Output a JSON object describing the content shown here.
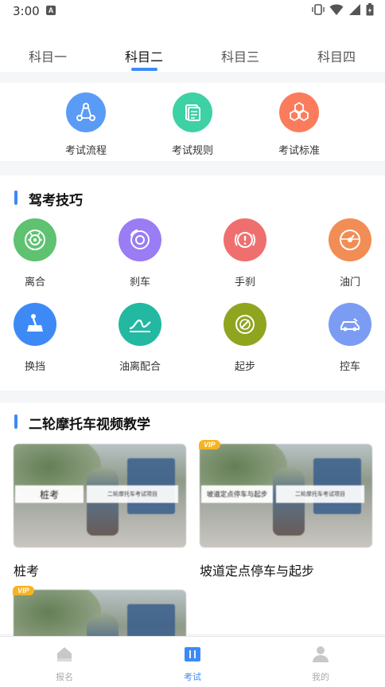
{
  "status_bar": {
    "time": "3:00",
    "notif_letter": "A"
  },
  "tabs": [
    {
      "label": "科目一"
    },
    {
      "label": "科目二"
    },
    {
      "label": "科目三"
    },
    {
      "label": "科目四"
    }
  ],
  "active_tab": 1,
  "quick_links": [
    {
      "label": "考试流程",
      "icon": "flow-icon",
      "color": "#5a9bf6"
    },
    {
      "label": "考试规则",
      "icon": "rules-icon",
      "color": "#3dd1a5"
    },
    {
      "label": "考试标准",
      "icon": "standard-icon",
      "color": "#fb7c5d"
    }
  ],
  "skills": {
    "title": "驾考技巧",
    "items": [
      {
        "label": "离合",
        "icon": "clutch-icon",
        "color": "#5ec270"
      },
      {
        "label": "刹车",
        "icon": "brake-icon",
        "color": "#9a7cf4"
      },
      {
        "label": "手刹",
        "icon": "handbrake-icon",
        "color": "#ef6f6f"
      },
      {
        "label": "油门",
        "icon": "throttle-icon",
        "color": "#f28d55"
      },
      {
        "label": "换挡",
        "icon": "gear-shift-icon",
        "color": "#3d8af7"
      },
      {
        "label": "油离配合",
        "icon": "coordination-icon",
        "color": "#22b8a1"
      },
      {
        "label": "起步",
        "icon": "start-icon",
        "color": "#8fa51f"
      },
      {
        "label": "控车",
        "icon": "car-control-icon",
        "color": "#7b9cf2"
      }
    ]
  },
  "videos": {
    "title": "二轮摩托车视频教学",
    "items": [
      {
        "title": "桩考",
        "band_main": "桩考",
        "band_sub": "二轮摩托车考试项目",
        "vip": false
      },
      {
        "title": "坡道定点停车与起步",
        "band_main": "坡道定点停车与起步",
        "band_sub": "二轮摩托车考试项目",
        "vip": true,
        "vip_label": "VIP"
      },
      {
        "title": "",
        "band_main": "",
        "band_sub": "",
        "vip": true,
        "vip_label": "VIP"
      }
    ]
  },
  "bottom_nav": [
    {
      "label": "报名",
      "icon": "home-icon"
    },
    {
      "label": "考试",
      "icon": "book-icon"
    },
    {
      "label": "我的",
      "icon": "user-icon"
    }
  ],
  "active_nav": 1,
  "colors": {
    "accent": "#3d8af7",
    "vip": "#f7b321"
  }
}
